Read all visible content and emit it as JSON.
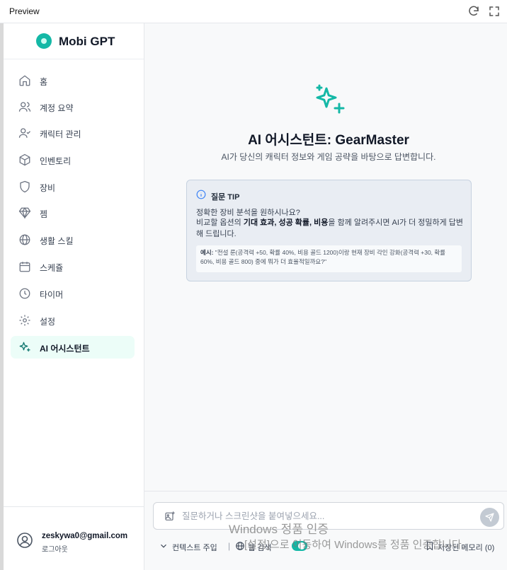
{
  "window": {
    "title": "Preview"
  },
  "brand": {
    "name": "Mobi GPT"
  },
  "sidebar": {
    "items": [
      {
        "label": "홈",
        "icon": "home-icon"
      },
      {
        "label": "계정 요약",
        "icon": "users-icon"
      },
      {
        "label": "캐릭터 관리",
        "icon": "user-check-icon"
      },
      {
        "label": "인벤토리",
        "icon": "box-icon"
      },
      {
        "label": "장비",
        "icon": "shield-icon"
      },
      {
        "label": "젬",
        "icon": "gem-icon"
      },
      {
        "label": "생활 스킬",
        "icon": "globe-icon"
      },
      {
        "label": "스케쥴",
        "icon": "calendar-icon"
      },
      {
        "label": "타이머",
        "icon": "clock-icon"
      },
      {
        "label": "설정",
        "icon": "gear-icon"
      },
      {
        "label": "AI 어시스턴트",
        "icon": "sparkles-icon",
        "active": true
      }
    ]
  },
  "user": {
    "email": "zeskywa0@gmail.com",
    "logout": "로그아웃"
  },
  "main": {
    "title": "AI 어시스턴트: GearMaster",
    "subtitle": "AI가 당신의 캐릭터 정보와 게임 공략을 바탕으로 답변합니다."
  },
  "tip": {
    "title": "질문 TIP",
    "question": "정확한 장비 분석을 원하시나요?",
    "body_pre": "비교할 옵션의 ",
    "body_bold1": "기대 효과, 성공 확률, 비용",
    "body_post": "을 함께 알려주시면 AI가 더 정밀하게 답변해 드립니다.",
    "example_label": "예시:",
    "example_text": " \"전설 룬(공격력 +50, 확률 40%, 비용 골드 1200)이랑 현재 장비 각인 강화(공격력 +30, 확률 60%, 비용 골드 800) 중에 뭐가 더 효율적일까요?\""
  },
  "input": {
    "placeholder": "질문하거나 스크린샷을 붙여넣으세요...",
    "context_label": "컨텍스트 주입",
    "separator": "|",
    "web_label": "웹 검색",
    "web_enabled": true,
    "memory_label": "저장된 메모리 (0)"
  },
  "watermark": {
    "line1": "Windows 정품 인증",
    "line2": "[설정]으로 이동하여 Windows를 정품 인증합니다."
  },
  "colors": {
    "accent": "#14b8a6",
    "active_bg": "#ecfdf8",
    "tip_bg": "#e9edf3"
  }
}
